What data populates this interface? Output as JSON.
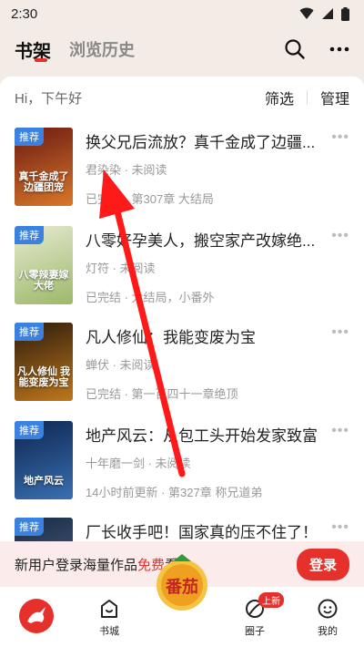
{
  "status": {
    "time": "2:30"
  },
  "header": {
    "tab_bookshelf": "书架",
    "tab_history": "浏览历史"
  },
  "greeting": {
    "text": "Hi，下午好",
    "filter_label": "筛选",
    "manage_label": "管理"
  },
  "books": [
    {
      "badge": "推荐",
      "cover_text": "真千金成了边疆团宠",
      "title": "换父兄后流放？真千金成了边疆...",
      "meta": "君染染 · 未阅读",
      "progress": "已完结 · 第307章 大结局",
      "cover_color_a": "#6b1a12",
      "cover_color_b": "#d8772a"
    },
    {
      "badge": "推荐",
      "cover_text": "八零辣妻嫁大佬",
      "title": "八零好孕美人，搬空家产改嫁绝...",
      "meta": "灯符 · 未阅读",
      "progress": "已完结 · 大结局，小番外",
      "cover_color_a": "#e6ead0",
      "cover_color_b": "#9db86a"
    },
    {
      "badge": "推荐",
      "cover_text": "凡人修仙 我能变废为宝",
      "title": "凡人修仙：我能变废为宝",
      "meta": "蝉伏 · 未阅读",
      "progress": "已完结 · 第一百四十一章绝顶",
      "cover_color_a": "#2a1a0c",
      "cover_color_b": "#c0781c"
    },
    {
      "badge": "推荐",
      "cover_text": "地产风云",
      "title": "地产风云：从包工头开始发家致富",
      "meta": "十年磨一剑 · 未阅读",
      "progress": "14小时前更新 · 第327章 称兄道弟",
      "cover_color_a": "#0d2550",
      "cover_color_b": "#3a6fb0"
    },
    {
      "badge": "推荐",
      "cover_text": "",
      "title": "厂长收手吧！国家真的压不住了！",
      "meta": "",
      "progress": "",
      "cover_color_a": "#1a2a44",
      "cover_color_b": "#4a6a8a"
    }
  ],
  "login_banner": {
    "text_before": "新用户登录海量作品",
    "text_highlight": "免费",
    "text_after": "看",
    "button_label": "登录"
  },
  "tabbar": {
    "bookstore_label": "书城",
    "fanqie_text": "番茄",
    "circle_label": "圈子",
    "circle_badge": "上新",
    "mine_label": "我的"
  },
  "colors": {
    "accent": "#e5302c",
    "badge_blue": "#3b82e0"
  }
}
